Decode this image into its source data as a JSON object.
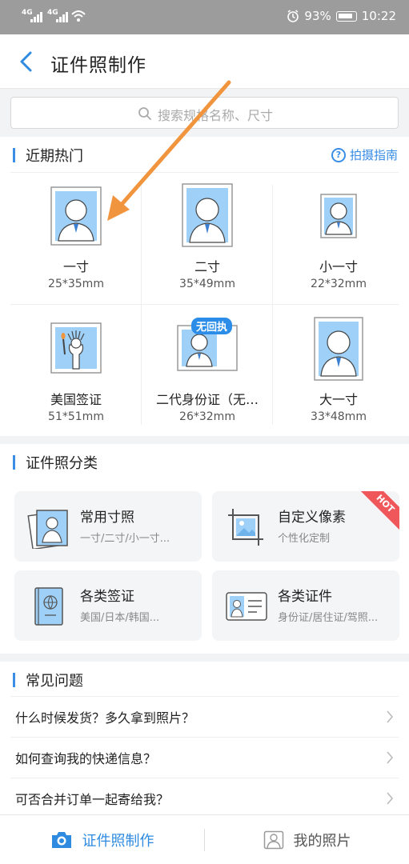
{
  "status": {
    "signal1": "4G",
    "signal2": "4G",
    "battery_pct": "93%",
    "time": "10:22"
  },
  "header": {
    "title": "证件照制作"
  },
  "search": {
    "placeholder": "搜索规格名称、尺寸"
  },
  "recent": {
    "title": "近期热门",
    "guide_label": "拍摄指南",
    "items": [
      {
        "name": "一寸",
        "size": "25*35mm"
      },
      {
        "name": "二寸",
        "size": "35*49mm"
      },
      {
        "name": "小一寸",
        "size": "22*32mm"
      },
      {
        "name": "美国签证",
        "size": "51*51mm"
      },
      {
        "name": "二代身份证（无…",
        "size": "26*32mm",
        "badge": "无回执"
      },
      {
        "name": "大一寸",
        "size": "33*48mm"
      }
    ]
  },
  "categories": {
    "title": "证件照分类",
    "items": [
      {
        "title": "常用寸照",
        "sub": "一寸/二寸/小一寸..."
      },
      {
        "title": "自定义像素",
        "sub": "个性化定制",
        "badge": "HOT"
      },
      {
        "title": "各类签证",
        "sub": "美国/日本/韩国..."
      },
      {
        "title": "各类证件",
        "sub": "身份证/居住证/驾照..."
      }
    ]
  },
  "faq": {
    "title": "常见问题",
    "items": [
      "什么时候发货？多久拿到照片？",
      "如何查询我的快递信息？",
      "可否合并订单一起寄给我？"
    ]
  },
  "tabs": [
    {
      "label": "证件照制作",
      "active": true
    },
    {
      "label": "我的照片",
      "active": false
    }
  ],
  "colors": {
    "accent": "#3a8ee6",
    "photo_bg": "#9fd0f7",
    "arrow": "#f0943d",
    "hot": "#f0575a"
  }
}
